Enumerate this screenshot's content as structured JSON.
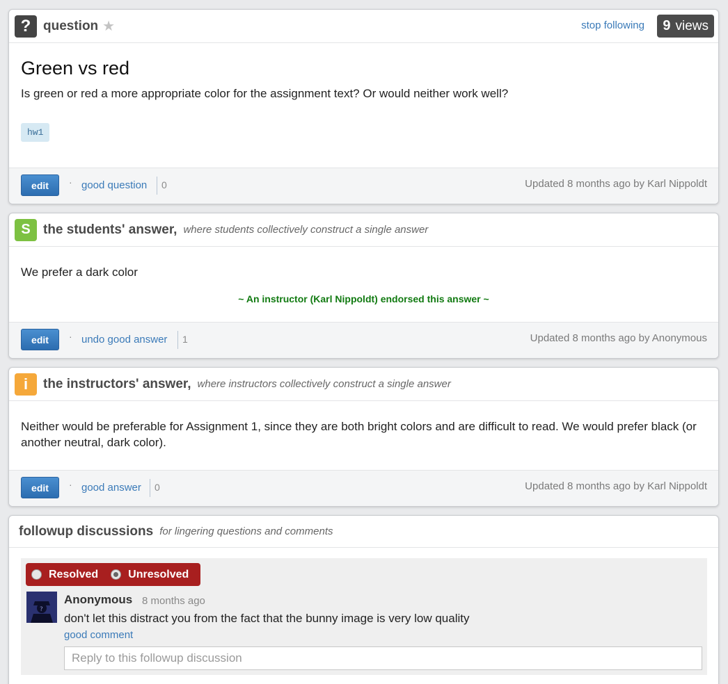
{
  "question": {
    "label": "question",
    "follow_link": "stop following",
    "views_count": "9",
    "views_label": "views",
    "title": "Green vs red",
    "body": "Is green or red a more appropriate color for the assignment text? Or would neither work well?",
    "tag": "hw1",
    "edit_label": "edit",
    "vote_label": "good question",
    "vote_count": "0",
    "updated": "Updated 8 months ago by Karl Nippoldt"
  },
  "students_answer": {
    "icon_letter": "S",
    "title": "the students' answer,",
    "subtitle": "where students collectively construct a single answer",
    "body": "We prefer a dark color",
    "endorsement": "~ An instructor (Karl Nippoldt) endorsed this answer  ~",
    "edit_label": "edit",
    "vote_label": "undo good answer",
    "vote_count": "1",
    "updated": "Updated 8 months ago by Anonymous"
  },
  "instructors_answer": {
    "icon_letter": "i",
    "title": "the instructors' answer,",
    "subtitle": "where instructors collectively construct a single answer",
    "body": "Neither would be preferable for Assignment 1, since they are both bright colors and are difficult to read. We would prefer black (or another neutral, dark color).",
    "edit_label": "edit",
    "vote_label": "good answer",
    "vote_count": "0",
    "updated": "Updated 8 months ago by Karl Nippoldt"
  },
  "followup": {
    "title": "followup discussions",
    "subtitle": "for lingering questions and comments",
    "resolved_label": "Resolved",
    "unresolved_label": "Unresolved",
    "selected": "Unresolved",
    "comment": {
      "author": "Anonymous",
      "time": "8 months ago",
      "text": "don't let this distract you from the fact that the bunny image is very low quality",
      "action": "good comment"
    },
    "reply_placeholder": "Reply to this followup discussion"
  },
  "colors": {
    "question_icon": "#444444",
    "students_icon": "#7dc142",
    "instructors_icon": "#f5a83a",
    "link": "#3a7ab8",
    "endorse": "#117a11",
    "resolve_bar": "#a81f1f"
  }
}
